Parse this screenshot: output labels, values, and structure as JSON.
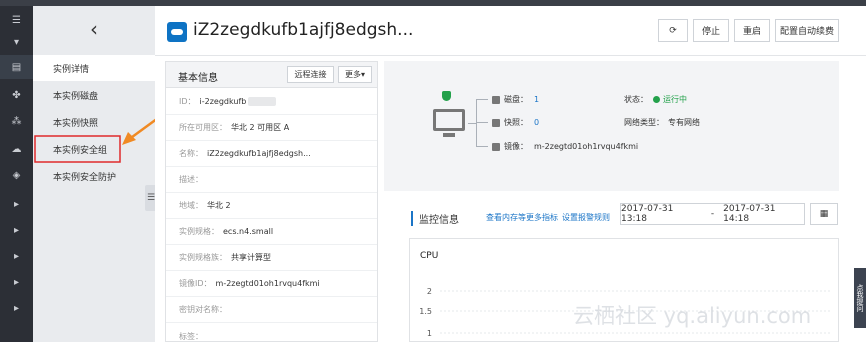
{
  "rail": {
    "icons": [
      "menu-icon",
      "dropdown-arrow-icon",
      "server-icon",
      "cluster-icon",
      "network-icon",
      "cloud-icon",
      "box-icon",
      "chevron-right-icon",
      "chevron-right-icon",
      "chevron-right-icon",
      "chevron-right-icon",
      "chevron-right-icon"
    ]
  },
  "sidebar": {
    "back": "‹",
    "items": [
      {
        "label": "实例详情"
      },
      {
        "label": "本实例磁盘"
      },
      {
        "label": "本实例快照"
      },
      {
        "label": "本实例安全组"
      },
      {
        "label": "本实例安全防护"
      }
    ]
  },
  "header": {
    "title": "iZ2zegdkufb1ajfj8edgsh...",
    "buttons": {
      "refresh": "⟳",
      "stop": "停止",
      "restart": "重启",
      "auto_renew": "配置自动续费"
    }
  },
  "basic_info": {
    "title": "基本信息",
    "remote_connect": "远程连接",
    "more": "更多▾",
    "rows": [
      {
        "key": "ID：",
        "value": "i-2zegdkufb"
      },
      {
        "key": "所在可用区：",
        "value": "华北 2 可用区 A"
      },
      {
        "key": "名称：",
        "value": "iZ2zegdkufb1ajfj8edgsh..."
      },
      {
        "key": "描述：",
        "value": ""
      },
      {
        "key": "地域：",
        "value": "华北 2"
      },
      {
        "key": "实例规格：",
        "value": "ecs.n4.small"
      },
      {
        "key": "实例规格族：",
        "value": "共享计算型"
      },
      {
        "key": "镜像ID：",
        "value": "m-2zegtd01oh1rvqu4fkmi"
      },
      {
        "key": "密钥对名称：",
        "value": ""
      },
      {
        "key": "标签：",
        "value": ""
      }
    ]
  },
  "topology": {
    "disk_label": "磁盘：",
    "disk_value": "1",
    "snapshot_label": "快照：",
    "snapshot_value": "0",
    "image_label": "镜像：",
    "image_value": "m-2zegtd01oh1rvqu4fkmi",
    "status_label": "状态：",
    "status_value": "运行中",
    "network_label": "网络类型：",
    "network_value": "专有网络",
    "status_color": "#23a14b"
  },
  "monitor": {
    "title": "监控信息",
    "more_metrics": "查看内存等更多指标",
    "alert_rules": "设置报警规则",
    "date_start": "2017-07-31 13:18",
    "date_sep": "-",
    "date_end": "2017-07-31 14:18",
    "calendar_icon": "▦"
  },
  "chart_data": {
    "type": "line",
    "title": "CPU",
    "yticks": [
      "2",
      "1.5",
      "1"
    ],
    "ylim": [
      1,
      2
    ]
  },
  "feedback": "点我提问",
  "watermark": "云栖社区 yq.aliyun.com"
}
